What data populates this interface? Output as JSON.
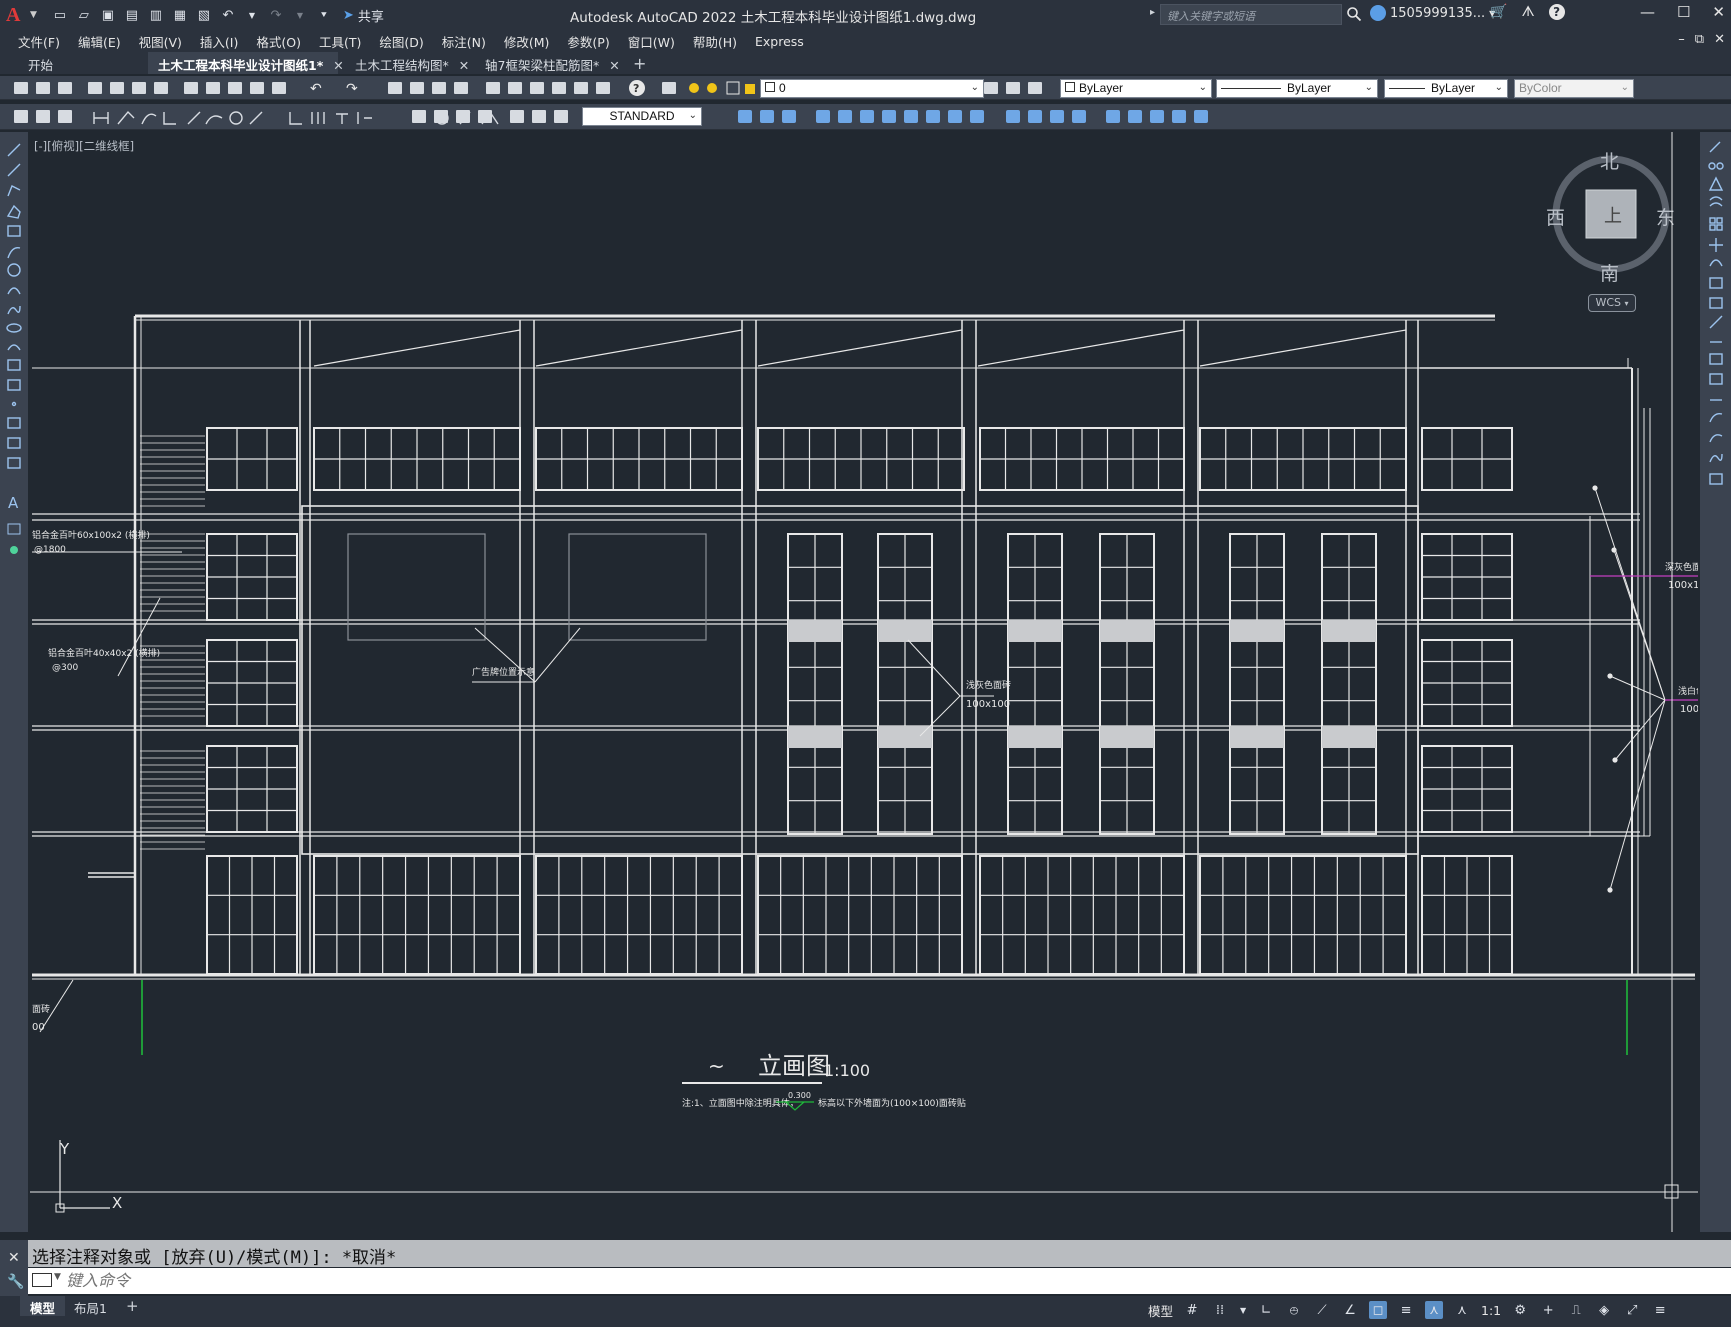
{
  "app": {
    "title": "Autodesk AutoCAD 2022    土木工程本科毕业设计图纸1.dwg.dwg",
    "share_label": "共享",
    "search_placeholder": "键入关键字或短语",
    "user_name": "1505999135...",
    "menu": [
      "文件(F)",
      "编辑(E)",
      "视图(V)",
      "插入(I)",
      "格式(O)",
      "工具(T)",
      "绘图(D)",
      "标注(N)",
      "修改(M)",
      "参数(P)",
      "窗口(W)",
      "帮助(H)",
      "Express"
    ],
    "tabs": [
      {
        "label": "开始",
        "active": false,
        "closable": false
      },
      {
        "label": "土木工程本科毕业设计图纸1*",
        "active": true,
        "closable": true
      },
      {
        "label": "土木工程结构图*",
        "active": false,
        "closable": true
      },
      {
        "label": "轴7框架梁柱配筋图*",
        "active": false,
        "closable": true
      }
    ]
  },
  "toolbar": {
    "layer_value": "0",
    "text_style": "STANDARD",
    "color_value": "ByLayer",
    "linetype_value": "ByLayer",
    "lineweight_value": "ByLayer",
    "plotstyle_value": "ByColor"
  },
  "viewport": {
    "view_label": "[-][俯视][二维线框]",
    "compass": {
      "north": "北",
      "south": "南",
      "east": "东",
      "west": "西",
      "center": "上"
    },
    "wcs_label": "WCS"
  },
  "drawing": {
    "title": "立画图",
    "title_prefix": "~",
    "scale": "1:100",
    "note": "注:1、立面图中除注明具体，",
    "note_level": "0.300",
    "note_tail": "标高以下外墙面为(100×100)面砖贴",
    "annotations": {
      "left_1": "铝合金百叶60x100x2 (横排)",
      "left_1b": "@1800",
      "left_2": "铝合金百叶40x40x2 (横排)",
      "left_2b": "@300",
      "center_1": "广告牌位置示意",
      "mid_1": "浅灰色面砖",
      "mid_1b": "100x100",
      "right_1": "深灰色面砖",
      "right_1b": "100x1",
      "right_2": "浅白色",
      "right_2b": "100",
      "bottom_left": "面砖",
      "bottom_left_b": "00"
    },
    "axis_y": "Y",
    "axis_x": "X"
  },
  "command": {
    "history": "选择注释对象或 [放弃(U)/模式(M)]: *取消*",
    "placeholder": "键入命令"
  },
  "status": {
    "layout_tabs": [
      {
        "label": "模型",
        "active": true
      },
      {
        "label": "布局1",
        "active": false
      }
    ],
    "model_label": "模型",
    "scale_label": "1:1"
  },
  "colors": {
    "background": "#212830",
    "line": "#e8e8e8",
    "accent_green": "#1fb83a",
    "accent_magenta": "#c43fc0",
    "logo_red": "#e03a3a"
  }
}
